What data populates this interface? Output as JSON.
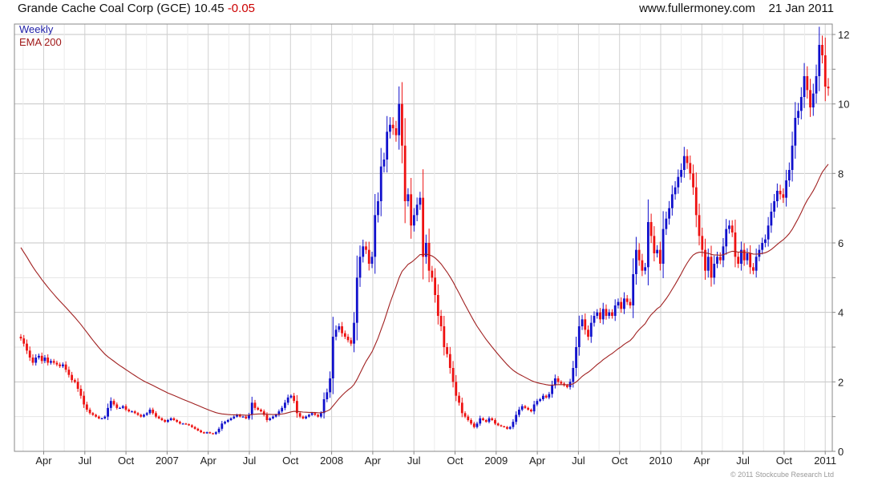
{
  "header": {
    "security": "Grande Cache Coal Corp (GCE)",
    "last": "10.45",
    "change": "-0.05",
    "site": "www.fullermoney.com",
    "date": "21 Jan 2011"
  },
  "legend": {
    "weekly": "Weekly",
    "ema": "EMA 200"
  },
  "copyright": "© 2011 Stockcube Research Ltd",
  "colors": {
    "up": "#1010cc",
    "down": "#ee1111",
    "ema": "#a02020",
    "grid": "#d8d8d8",
    "frame": "#888888"
  },
  "chart_data": {
    "type": "candlestick",
    "title": "Grande Cache Coal Corp (GCE)",
    "ylim": [
      0,
      12.3
    ],
    "y_ticks": [
      "0",
      "2",
      "4",
      "6",
      "8",
      "10",
      "12"
    ],
    "x_ticks": [
      "Apr",
      "Jul",
      "Oct",
      "2007",
      "Apr",
      "Jul",
      "Oct",
      "2008",
      "Apr",
      "Jul",
      "Oct",
      "2009",
      "Apr",
      "Jul",
      "Oct",
      "2010",
      "Apr",
      "Jul",
      "Oct",
      "2011"
    ],
    "close": [
      3.25,
      3.1,
      2.9,
      2.7,
      2.55,
      2.7,
      2.75,
      2.6,
      2.7,
      2.55,
      2.6,
      2.55,
      2.5,
      2.45,
      2.5,
      2.35,
      2.2,
      2.05,
      2.0,
      1.8,
      1.6,
      1.35,
      1.2,
      1.1,
      1.05,
      1.0,
      0.95,
      0.95,
      1.0,
      1.25,
      1.45,
      1.35,
      1.25,
      1.25,
      1.3,
      1.2,
      1.15,
      1.15,
      1.1,
      1.05,
      1.0,
      1.05,
      1.1,
      1.2,
      1.1,
      1.0,
      0.95,
      0.9,
      0.85,
      0.9,
      0.95,
      0.9,
      0.85,
      0.8,
      0.8,
      0.78,
      0.75,
      0.7,
      0.65,
      0.6,
      0.55,
      0.52,
      0.55,
      0.52,
      0.5,
      0.55,
      0.65,
      0.8,
      0.85,
      0.9,
      0.95,
      1.0,
      1.05,
      1.0,
      1.0,
      0.95,
      1.05,
      1.4,
      1.25,
      1.2,
      1.15,
      1.05,
      0.9,
      0.95,
      1.0,
      1.05,
      1.15,
      1.25,
      1.4,
      1.55,
      1.6,
      1.45,
      1.1,
      1.0,
      0.95,
      1.0,
      1.05,
      1.1,
      1.05,
      1.0,
      1.1,
      1.5,
      1.7,
      2.1,
      3.3,
      3.5,
      3.6,
      3.4,
      3.3,
      3.2,
      3.1,
      3.7,
      5.0,
      5.6,
      5.9,
      5.8,
      5.4,
      5.6,
      6.8,
      7.2,
      8.2,
      8.4,
      9.2,
      9.4,
      9.3,
      9.1,
      10.0,
      8.8,
      7.2,
      7.4,
      6.5,
      6.8,
      7.1,
      7.3,
      5.6,
      6.0,
      5.2,
      5.0,
      4.5,
      3.9,
      3.6,
      3.0,
      2.8,
      2.4,
      2.0,
      1.6,
      1.4,
      1.1,
      1.0,
      0.9,
      0.8,
      0.7,
      0.8,
      0.95,
      0.9,
      0.85,
      0.95,
      0.9,
      0.8,
      0.75,
      0.72,
      0.7,
      0.65,
      0.7,
      0.85,
      1.05,
      1.2,
      1.3,
      1.25,
      1.2,
      1.15,
      1.35,
      1.45,
      1.5,
      1.6,
      1.55,
      1.65,
      1.9,
      2.1,
      2.0,
      1.95,
      1.9,
      1.85,
      2.0,
      2.4,
      3.0,
      3.6,
      3.8,
      3.5,
      3.3,
      3.7,
      3.9,
      4.0,
      3.8,
      4.1,
      3.9,
      4.0,
      3.9,
      4.2,
      4.3,
      4.1,
      4.4,
      4.3,
      4.2,
      5.1,
      5.8,
      5.5,
      5.2,
      5.3,
      6.6,
      6.2,
      5.7,
      5.8,
      5.4,
      6.4,
      6.7,
      7.0,
      7.4,
      7.6,
      7.9,
      8.1,
      8.5,
      8.3,
      8.0,
      7.6,
      6.8,
      6.2,
      5.8,
      5.2,
      5.6,
      5.0,
      5.4,
      5.6,
      5.5,
      5.9,
      6.4,
      6.5,
      6.3,
      5.6,
      5.4,
      5.8,
      5.5,
      5.7,
      5.3,
      5.2,
      5.6,
      5.8,
      6.0,
      6.1,
      6.5,
      6.9,
      7.2,
      7.5,
      7.4,
      7.3,
      7.8,
      8.1,
      8.8,
      9.6,
      9.8,
      10.2,
      10.8,
      10.4,
      9.9,
      10.3,
      10.8,
      11.7,
      11.4,
      10.5,
      10.45
    ]
  }
}
